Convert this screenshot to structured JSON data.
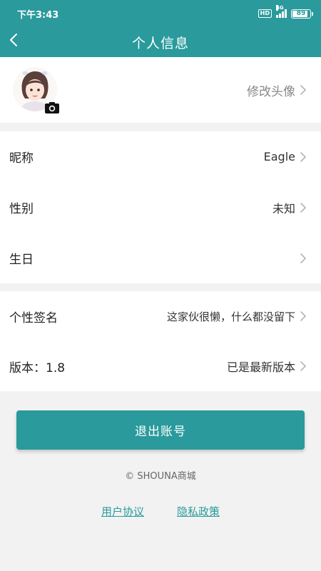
{
  "status_bar": {
    "time": "下午3:43",
    "hd": "HD",
    "network": "4G",
    "battery": "89"
  },
  "nav": {
    "title": "个人信息",
    "back_icon": "chevron-left-icon"
  },
  "avatar_row": {
    "link_label": "修改头像",
    "camera_icon": "camera-icon"
  },
  "profile_rows": [
    {
      "label": "昵称",
      "value": "Eagle"
    },
    {
      "label": "性别",
      "value": "未知"
    },
    {
      "label": "生日",
      "value": ""
    }
  ],
  "extra_rows": [
    {
      "label": "个性签名",
      "value": "这家伙很懒，什么都没留下"
    },
    {
      "label": "版本：1.8",
      "value": "已是最新版本"
    }
  ],
  "logout_label": "退出账号",
  "copyright": "© SHOUNA商城",
  "links": {
    "user_agreement": "用户协议",
    "privacy_policy": "隐私政策"
  },
  "colors": {
    "brand": "#2a9a9c",
    "background": "#f2f2f2",
    "chevron": "#b5b5b5"
  }
}
